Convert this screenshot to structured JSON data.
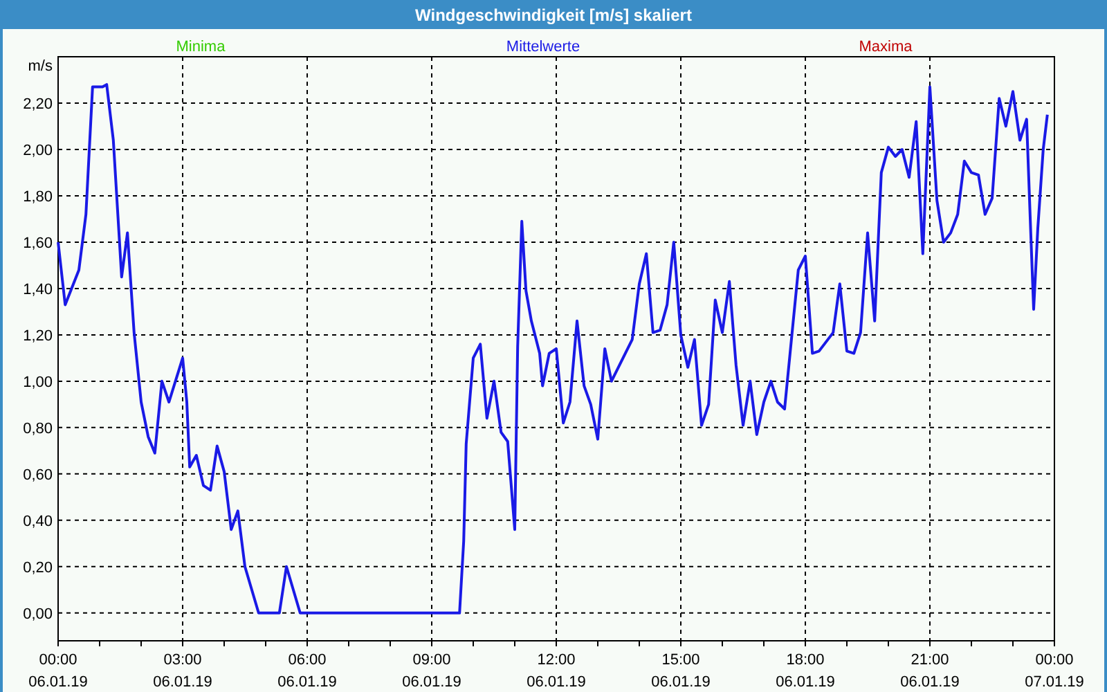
{
  "window": {
    "title": "Windgeschwindigkeit [m/s] skaliert"
  },
  "chart": {
    "legend": [
      {
        "label": "Minima",
        "color": "#33cc00"
      },
      {
        "label": "Maxima",
        "color": "#c00000"
      }
    ],
    "x_axis_dates": [
      "06.01.19",
      "06.01.19",
      "06.01.19",
      "06.01.19",
      "06.01.19",
      "06.01.19",
      "06.01.19",
      "06.01.19",
      "07.01.19"
    ],
    "chart_data": {
      "type": "line",
      "grid": true,
      "ylabel": "m/s",
      "x": [
        0,
        0.17,
        0.5,
        0.67,
        0.83,
        1.07,
        1.17,
        1.33,
        1.53,
        1.67,
        1.83,
        2,
        2.17,
        2.33,
        2.5,
        2.67,
        3,
        3.1,
        3.17,
        3.33,
        3.5,
        3.67,
        3.83,
        4,
        4.17,
        4.33,
        4.5,
        4.83,
        5.33,
        5.5,
        5.83,
        9.67,
        9.77,
        9.83,
        10,
        10.17,
        10.33,
        10.5,
        10.67,
        10.83,
        11,
        11.07,
        11.17,
        11.27,
        11.4,
        11.6,
        11.67,
        11.83,
        12,
        12.17,
        12.33,
        12.5,
        12.67,
        12.83,
        13,
        13.17,
        13.33,
        13.83,
        14,
        14.17,
        14.33,
        14.5,
        14.67,
        14.83,
        15,
        15.17,
        15.33,
        15.5,
        15.67,
        15.83,
        16,
        16.17,
        16.33,
        16.5,
        16.67,
        16.83,
        17,
        17.17,
        17.33,
        17.5,
        17.83,
        18,
        18.17,
        18.33,
        18.67,
        18.83,
        19,
        19.17,
        19.33,
        19.5,
        19.67,
        19.83,
        20,
        20.17,
        20.33,
        20.5,
        20.67,
        20.83,
        21,
        21.17,
        21.33,
        21.5,
        21.67,
        21.83,
        22,
        22.17,
        22.33,
        22.5,
        22.67,
        22.83,
        23,
        23.17,
        23.33,
        23.43,
        23.5,
        23.6,
        23.73,
        23.83
      ],
      "series": [
        {
          "name": "Mittelwerte",
          "color": "#1a1ae6",
          "values": [
            1.6,
            1.33,
            1.48,
            1.72,
            2.27,
            2.27,
            2.28,
            2.04,
            1.45,
            1.64,
            1.21,
            0.91,
            0.76,
            0.69,
            1.0,
            0.91,
            1.1,
            0.91,
            0.63,
            0.68,
            0.55,
            0.53,
            0.72,
            0.61,
            0.36,
            0.44,
            0.2,
            0,
            0,
            0.2,
            0,
            0,
            0.31,
            0.73,
            1.1,
            1.16,
            0.84,
            1.0,
            0.78,
            0.74,
            0.36,
            1.15,
            1.69,
            1.39,
            1.26,
            1.12,
            0.98,
            1.12,
            1.14,
            0.82,
            0.91,
            1.26,
            0.98,
            0.9,
            0.75,
            1.14,
            1.0,
            1.18,
            1.42,
            1.55,
            1.21,
            1.22,
            1.33,
            1.6,
            1.2,
            1.06,
            1.18,
            0.81,
            0.9,
            1.35,
            1.21,
            1.43,
            1.07,
            0.81,
            1.0,
            0.77,
            0.91,
            1.0,
            0.91,
            0.88,
            1.48,
            1.54,
            1.12,
            1.13,
            1.21,
            1.42,
            1.13,
            1.12,
            1.21,
            1.64,
            1.26,
            1.9,
            2.01,
            1.97,
            2.0,
            1.88,
            2.12,
            1.55,
            2.27,
            1.78,
            1.6,
            1.64,
            1.72,
            1.95,
            1.9,
            1.89,
            1.72,
            1.79,
            2.22,
            2.1,
            2.25,
            2.04,
            2.13,
            1.64,
            1.31,
            1.66,
            2.0,
            2.15
          ]
        }
      ],
      "xlim": [
        0,
        24
      ],
      "ylim": [
        -0.12,
        2.4
      ],
      "xticks": [
        {
          "value": 0,
          "label": "00:00"
        },
        {
          "value": 3,
          "label": "03:00"
        },
        {
          "value": 6,
          "label": "06:00"
        },
        {
          "value": 9,
          "label": "09:00"
        },
        {
          "value": 12,
          "label": "12:00"
        },
        {
          "value": 15,
          "label": "15:00"
        },
        {
          "value": 18,
          "label": "18:00"
        },
        {
          "value": 21,
          "label": "21:00"
        },
        {
          "value": 24,
          "label": "00:00"
        }
      ],
      "yticks": [
        {
          "value": 0,
          "label": "0,00"
        },
        {
          "value": 0.2,
          "label": "0,20"
        },
        {
          "value": 0.4,
          "label": "0,40"
        },
        {
          "value": 0.6,
          "label": "0,60"
        },
        {
          "value": 0.8,
          "label": "0,80"
        },
        {
          "value": 1,
          "label": "1,00"
        },
        {
          "value": 1.2,
          "label": "1,20"
        },
        {
          "value": 1.4,
          "label": "1,40"
        },
        {
          "value": 1.6,
          "label": "1,60"
        },
        {
          "value": 1.8,
          "label": "1,80"
        },
        {
          "value": 2,
          "label": "2,00"
        },
        {
          "value": 2.2,
          "label": "2,20"
        }
      ]
    }
  }
}
